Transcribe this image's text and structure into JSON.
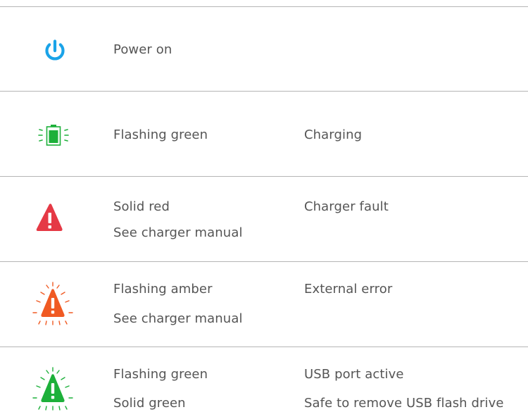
{
  "colors": {
    "power": "#1aa3e8",
    "green": "#1db03a",
    "red": "#e53945",
    "amber": "#f05a23",
    "divider": "#b5b5b5",
    "text": "#555555"
  },
  "rows": [
    {
      "icon": "power-icon",
      "lines": [
        {
          "indicator": "Power on",
          "meaning": ""
        }
      ]
    },
    {
      "icon": "battery-charging-icon",
      "lines": [
        {
          "indicator": "Flashing green",
          "meaning": "Charging"
        }
      ]
    },
    {
      "icon": "warning-triangle-icon",
      "lines": [
        {
          "indicator": "Solid red",
          "meaning": "Charger fault"
        },
        {
          "indicator": "See charger manual",
          "meaning": ""
        }
      ]
    },
    {
      "icon": "flashing-warning-triangle-icon",
      "lines": [
        {
          "indicator": "Flashing amber",
          "meaning": "External error"
        },
        {
          "indicator": "See charger manual",
          "meaning": ""
        }
      ]
    },
    {
      "icon": "flashing-warning-triangle-icon",
      "lines": [
        {
          "indicator": "Flashing green",
          "meaning": "USB port active"
        },
        {
          "indicator": "Solid green",
          "meaning": "Safe to remove USB flash drive"
        }
      ]
    }
  ]
}
